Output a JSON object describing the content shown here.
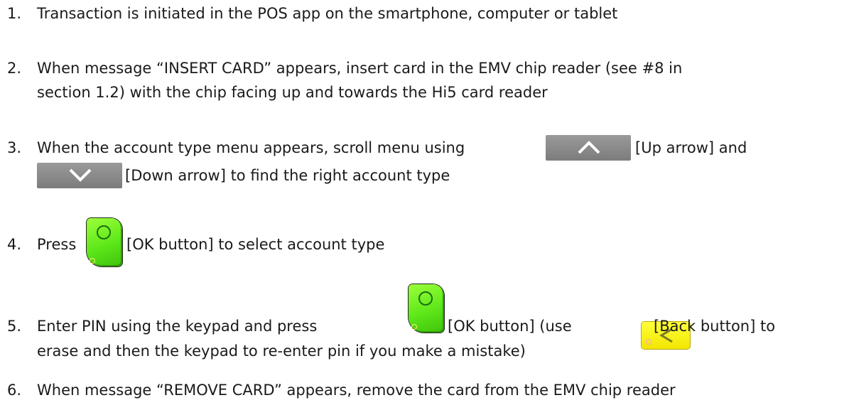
{
  "steps": [
    {
      "number": "1.",
      "lines": [
        "Transaction is initiated in the POS app on the smartphone, computer or tablet"
      ]
    },
    {
      "number": "2.",
      "lines": [
        "When message “INSERT CARD” appears, insert card in the EMV chip reader (see #8 in",
        "section 1.2)  with the chip facing up and towards the Hi5 card reader"
      ]
    },
    {
      "number": "3.",
      "line1_pre": "When the account type menu appears, scroll menu using",
      "line1_post": "[Up arrow] and",
      "line2_post": "[Down arrow] to find the right account type"
    },
    {
      "number": "4.",
      "pre": "Press",
      "post": "[OK button] to select account type"
    },
    {
      "number": "5.",
      "line1_pre": "Enter PIN using the keypad and press",
      "line1_mid": "[OK button] (use",
      "line1_post": "[Back button] to",
      "line2": "erase and then the keypad to re-enter pin if you make a mistake)"
    },
    {
      "number": "6.",
      "lines": [
        "When message “REMOVE CARD” appears, remove the card from the EMV chip reader"
      ]
    }
  ],
  "icons": {
    "up_arrow": "up-arrow-key",
    "down_arrow": "down-arrow-key",
    "ok": "ok-button-key",
    "back": "back-button-key"
  }
}
